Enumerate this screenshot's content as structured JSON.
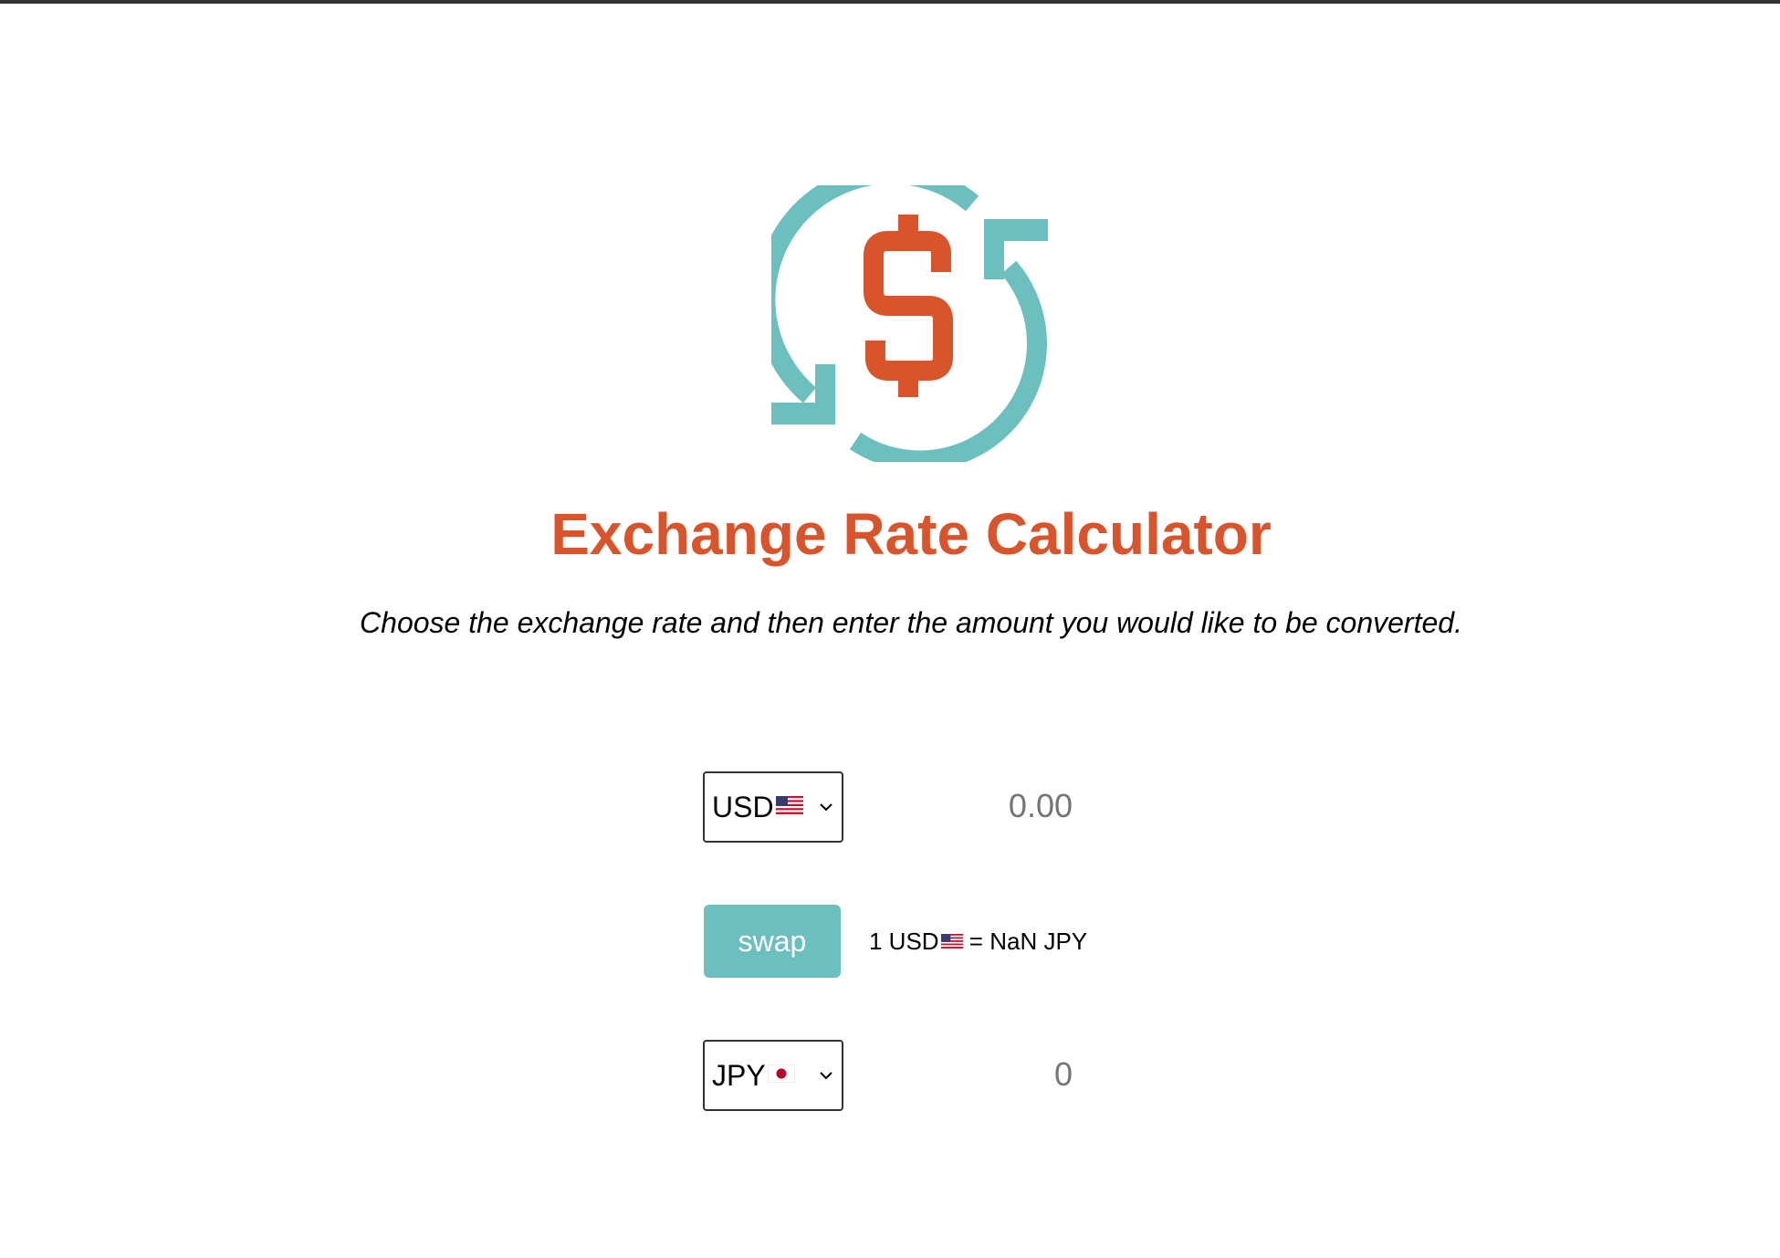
{
  "colors": {
    "accent": "#d9532b",
    "teal": "#6bc0bf",
    "text": "#000000",
    "muted": "#777777"
  },
  "header": {
    "logo_icon": "currency-exchange-icon",
    "title": "Exchange Rate Calculator",
    "subtitle": "Choose the exchange rate and then enter the amount you would like to be converted."
  },
  "converter": {
    "currency_one": {
      "selected": "USD",
      "flag": "us-flag-icon",
      "amount_placeholder": "0.00",
      "amount_value": ""
    },
    "swap_label": "swap",
    "rate": {
      "prefix": "1 USD",
      "suffix": " = NaN JPY"
    },
    "currency_two": {
      "selected": "JPY",
      "flag": "jp-flag-icon",
      "amount_placeholder": "",
      "amount_value": "0"
    }
  }
}
